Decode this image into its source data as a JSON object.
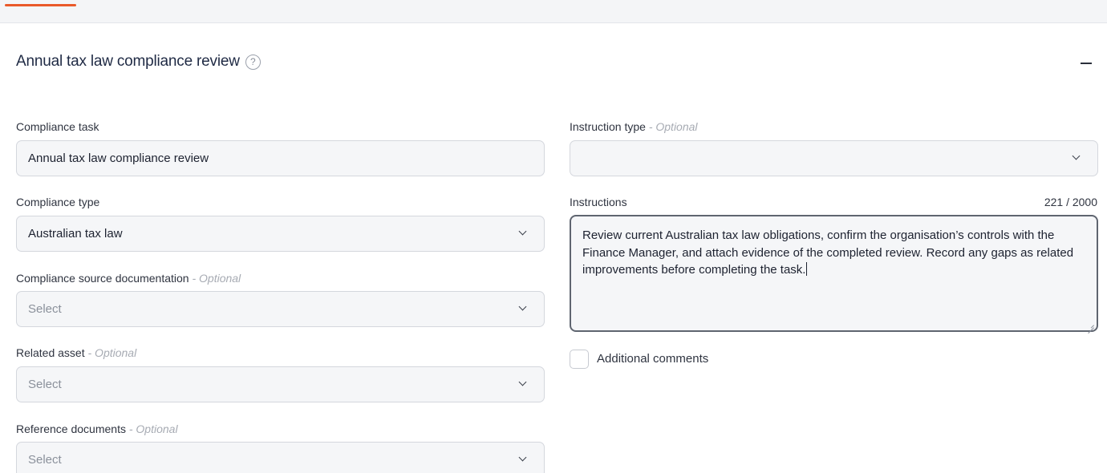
{
  "section": {
    "title": "Annual tax law compliance review",
    "help_icon": "question-circle-icon",
    "collapse_icon": "minus-icon"
  },
  "optional_suffix": "- Optional",
  "left": {
    "compliance_task": {
      "label": "Compliance task",
      "value": "Annual tax law compliance review"
    },
    "compliance_type": {
      "label": "Compliance type",
      "value": "Australian tax law"
    },
    "source_documentation": {
      "label": "Compliance source documentation",
      "placeholder": "Select"
    },
    "related_asset": {
      "label": "Related asset",
      "placeholder": "Select"
    },
    "reference_documents": {
      "label": "Reference documents",
      "placeholder": "Select"
    }
  },
  "right": {
    "instruction_type": {
      "label": "Instruction type",
      "value": ""
    },
    "instructions": {
      "label": "Instructions",
      "counter": "221 / 2000",
      "value": "Review current Australian tax law obligations, confirm the organisation’s controls with the Finance Manager, and attach evidence of the completed review. Record any gaps as related improvements before completing the task."
    },
    "additional_comments": {
      "label": "Additional comments",
      "checked": false
    }
  },
  "colors": {
    "accent": "#ea5a2a",
    "title": "#1f2a44",
    "field_bg": "#f5f6f8",
    "field_border": "#d4d7dd"
  }
}
